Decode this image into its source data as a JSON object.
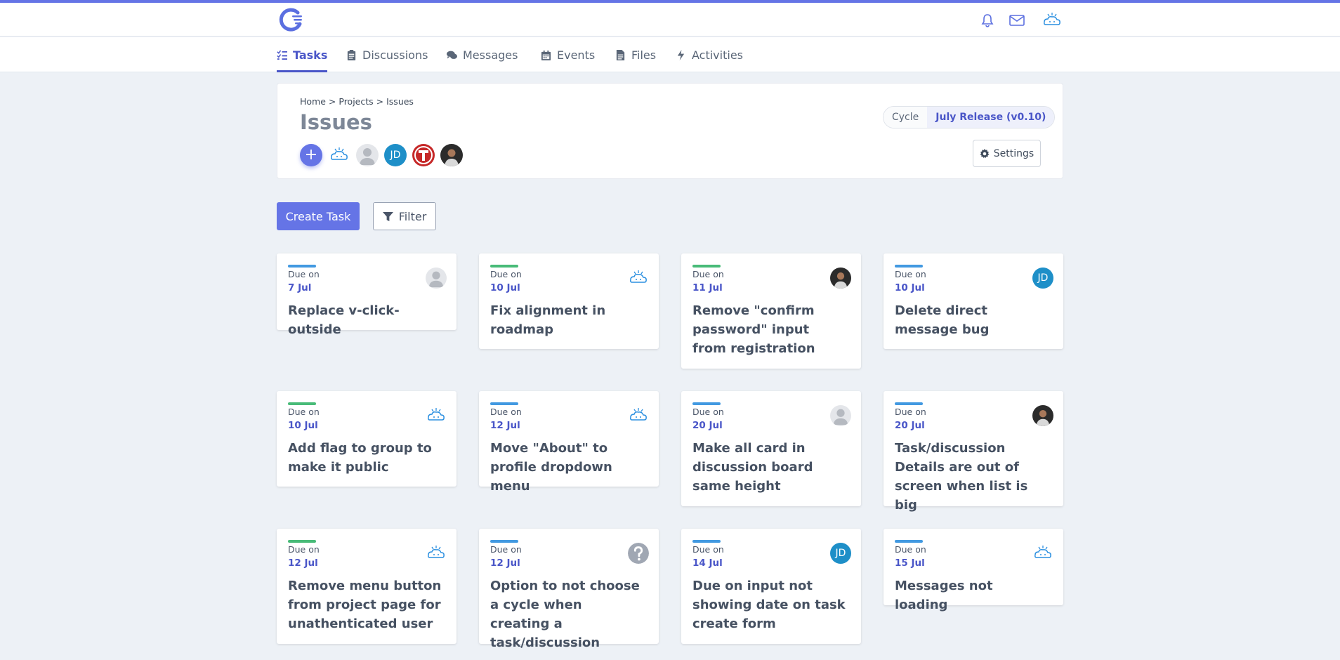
{
  "colors": {
    "accent": "#6574e6",
    "blue_bar": "#4299e1",
    "green_bar": "#48bb78",
    "active_tab": "#4a56c8"
  },
  "topbar": {
    "icons": [
      "bell-icon",
      "envelope-icon",
      "user-avatar"
    ]
  },
  "nav": {
    "tabs": [
      {
        "label": "Tasks",
        "icon": "tasks-icon",
        "active": true
      },
      {
        "label": "Discussions",
        "icon": "clipboard-icon",
        "active": false
      },
      {
        "label": "Messages",
        "icon": "comments-icon",
        "active": false
      },
      {
        "label": "Events",
        "icon": "calendar-icon",
        "active": false
      },
      {
        "label": "Files",
        "icon": "file-icon",
        "active": false
      },
      {
        "label": "Activities",
        "icon": "bolt-icon",
        "active": false
      }
    ]
  },
  "header": {
    "breadcrumb": {
      "home": "Home",
      "sep1": ">",
      "projects": "Projects",
      "sep2": ">",
      "current": "Issues"
    },
    "title": "Issues",
    "add_member_label": "+",
    "jd_initials": "JD",
    "cycle_label": "Cycle",
    "cycle_value": "July Release (v0.10)",
    "settings_label": "Settings"
  },
  "toolbar": {
    "create_label": "Create Task",
    "filter_label": "Filter"
  },
  "tasks": [
    {
      "due_label": "Due on",
      "due": "7 Jul",
      "title": "Replace v-click-outside",
      "bar": "blue",
      "avatar": "gray"
    },
    {
      "due_label": "Due on",
      "due": "10 Jul",
      "title": "Fix alignment in roadmap",
      "bar": "green",
      "avatar": "cloud"
    },
    {
      "due_label": "Due on",
      "due": "11 Jul",
      "title": "Remove \"confirm password\" input from registration",
      "bar": "green",
      "avatar": "dark"
    },
    {
      "due_label": "Due on",
      "due": "10 Jul",
      "title": "Delete direct message bug",
      "bar": "blue",
      "avatar": "jd",
      "initials": "JD"
    },
    {
      "due_label": "Due on",
      "due": "10 Jul",
      "title": "Add flag to group to make it public",
      "bar": "green",
      "avatar": "cloud"
    },
    {
      "due_label": "Due on",
      "due": "12 Jul",
      "title": "Move \"About\" to profile dropdown menu",
      "bar": "blue",
      "avatar": "cloud"
    },
    {
      "due_label": "Due on",
      "due": "20 Jul",
      "title": "Make all card in discussion board same height",
      "bar": "blue",
      "avatar": "gray"
    },
    {
      "due_label": "Due on",
      "due": "20 Jul",
      "title": "Task/discussion Details are out of screen when list is big",
      "bar": "blue",
      "avatar": "dark"
    },
    {
      "due_label": "Due on",
      "due": "12 Jul",
      "title": "Remove menu button from project page for unathenticated user",
      "bar": "green",
      "avatar": "cloud"
    },
    {
      "due_label": "Due on",
      "due": "12 Jul",
      "title": "Option to not choose a cycle when creating a task/discussion",
      "bar": "blue",
      "avatar": "unknown"
    },
    {
      "due_label": "Due on",
      "due": "14 Jul",
      "title": "Due on input not showing date on task create form",
      "bar": "blue",
      "avatar": "jd",
      "initials": "JD"
    },
    {
      "due_label": "Due on",
      "due": "15 Jul",
      "title": "Messages not loading",
      "bar": "blue",
      "avatar": "cloud"
    }
  ]
}
